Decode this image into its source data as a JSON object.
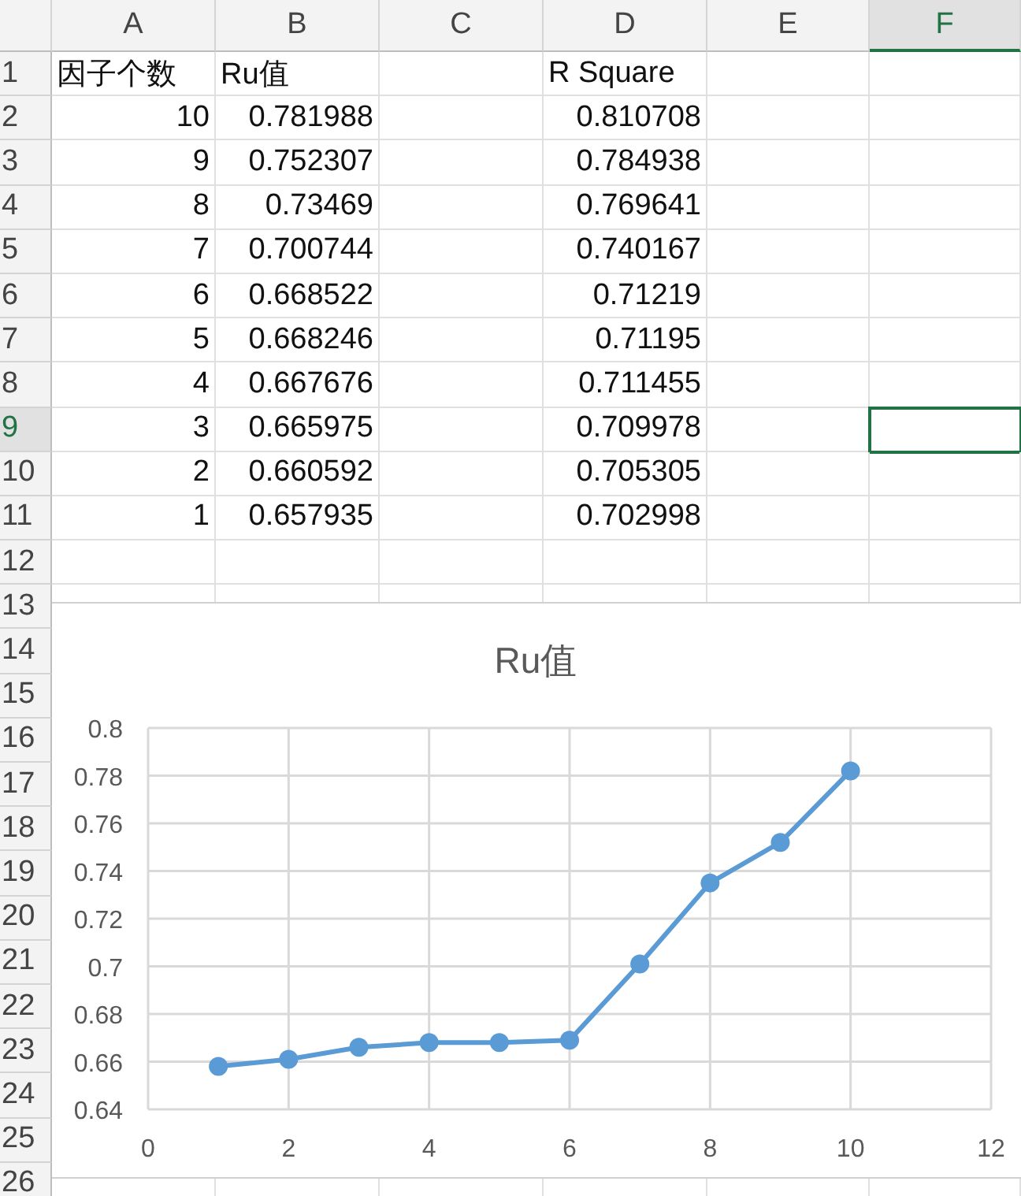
{
  "column_headers": [
    {
      "label": "A",
      "selected": false
    },
    {
      "label": "B",
      "selected": false
    },
    {
      "label": "C",
      "selected": false
    },
    {
      "label": "D",
      "selected": false
    },
    {
      "label": "E",
      "selected": false
    },
    {
      "label": "F",
      "selected": true
    }
  ],
  "row_headers": [
    {
      "label": "1",
      "selected": false
    },
    {
      "label": "2",
      "selected": false
    },
    {
      "label": "3",
      "selected": false
    },
    {
      "label": "4",
      "selected": false
    },
    {
      "label": "5",
      "selected": false
    },
    {
      "label": "6",
      "selected": false
    },
    {
      "label": "7",
      "selected": false
    },
    {
      "label": "8",
      "selected": false
    },
    {
      "label": "9",
      "selected": true
    },
    {
      "label": "10",
      "selected": false
    },
    {
      "label": "11",
      "selected": false
    },
    {
      "label": "12",
      "selected": false
    },
    {
      "label": "13",
      "selected": false
    },
    {
      "label": "14",
      "selected": false
    },
    {
      "label": "15",
      "selected": false
    },
    {
      "label": "16",
      "selected": false
    },
    {
      "label": "17",
      "selected": false
    },
    {
      "label": "18",
      "selected": false
    },
    {
      "label": "19",
      "selected": false
    },
    {
      "label": "20",
      "selected": false
    },
    {
      "label": "21",
      "selected": false
    },
    {
      "label": "22",
      "selected": false
    },
    {
      "label": "23",
      "selected": false
    },
    {
      "label": "24",
      "selected": false
    },
    {
      "label": "25",
      "selected": false
    },
    {
      "label": "26",
      "selected": false
    }
  ],
  "rows": [
    {
      "a": {
        "text": "因子个数",
        "kind": "text"
      },
      "b": {
        "text": "Ru值",
        "kind": "text"
      },
      "d": {
        "text": "R Square",
        "kind": "text"
      }
    },
    {
      "a": {
        "text": "10",
        "kind": "number"
      },
      "b": {
        "text": "0.781988",
        "kind": "number"
      },
      "d": {
        "text": "0.810708",
        "kind": "number"
      }
    },
    {
      "a": {
        "text": "9",
        "kind": "number"
      },
      "b": {
        "text": "0.752307",
        "kind": "number"
      },
      "d": {
        "text": "0.784938",
        "kind": "number"
      }
    },
    {
      "a": {
        "text": "8",
        "kind": "number"
      },
      "b": {
        "text": "0.73469",
        "kind": "number"
      },
      "d": {
        "text": "0.769641",
        "kind": "number"
      }
    },
    {
      "a": {
        "text": "7",
        "kind": "number"
      },
      "b": {
        "text": "0.700744",
        "kind": "number"
      },
      "d": {
        "text": "0.740167",
        "kind": "number"
      }
    },
    {
      "a": {
        "text": "6",
        "kind": "number"
      },
      "b": {
        "text": "0.668522",
        "kind": "number"
      },
      "d": {
        "text": "0.71219",
        "kind": "number"
      }
    },
    {
      "a": {
        "text": "5",
        "kind": "number"
      },
      "b": {
        "text": "0.668246",
        "kind": "number"
      },
      "d": {
        "text": "0.71195",
        "kind": "number"
      }
    },
    {
      "a": {
        "text": "4",
        "kind": "number"
      },
      "b": {
        "text": "0.667676",
        "kind": "number"
      },
      "d": {
        "text": "0.711455",
        "kind": "number"
      }
    },
    {
      "a": {
        "text": "3",
        "kind": "number"
      },
      "b": {
        "text": "0.665975",
        "kind": "number"
      },
      "d": {
        "text": "0.709978",
        "kind": "number"
      }
    },
    {
      "a": {
        "text": "2",
        "kind": "number"
      },
      "b": {
        "text": "0.660592",
        "kind": "number"
      },
      "d": {
        "text": "0.705305",
        "kind": "number"
      }
    },
    {
      "a": {
        "text": "1",
        "kind": "number"
      },
      "b": {
        "text": "0.657935",
        "kind": "number"
      },
      "d": {
        "text": "0.702998",
        "kind": "number"
      }
    }
  ],
  "chart": {
    "chart_data": {
      "type": "line",
      "title": "Ru值",
      "x": [
        1,
        2,
        3,
        4,
        5,
        6,
        7,
        8,
        9,
        10
      ],
      "series": [
        {
          "color": "#5b9bd5",
          "marker": true,
          "values": [
            0.658,
            0.661,
            0.666,
            0.668,
            0.668,
            0.669,
            0.701,
            0.735,
            0.752,
            0.782
          ]
        }
      ],
      "grid": true,
      "xlim": [
        0,
        12
      ],
      "ylim": [
        0.64,
        0.8
      ],
      "xticks": [
        0,
        2,
        4,
        6,
        8,
        10,
        12
      ],
      "yticks": [
        0.64,
        0.66,
        0.68,
        0.7,
        0.72,
        0.74,
        0.76,
        0.78,
        0.8
      ]
    }
  }
}
